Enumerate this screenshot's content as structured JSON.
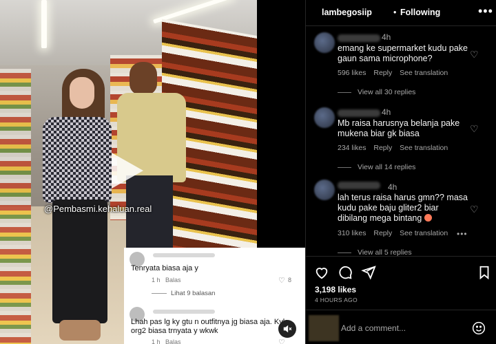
{
  "post": {
    "username": "lambegosiip",
    "separator": "•",
    "follow_status": "Following",
    "likes": "3,198 likes",
    "time_ago": "4 HOURS AGO",
    "comment_placeholder": "Add a comment..."
  },
  "video": {
    "watermark": "@Pembasmi.kehaluan.real",
    "overlay_comments": [
      {
        "text": "Tenryata biasa aja y",
        "time": "1 h",
        "reply": "Balas",
        "likes": "8",
        "view_replies": "Lihat 9 balasan"
      },
      {
        "text_line1": "Lhah pas lg ky gtu n outfitnya jg biasa aja. Kyk",
        "text_line2": "org2 biasa trnyata y wkwk",
        "time": "1 h",
        "reply": "Balas"
      }
    ]
  },
  "comments": [
    {
      "time": "4h",
      "text": "emang ke supermarket kudu pake gaun sama microphone?",
      "likes": "596 likes",
      "reply": "Reply",
      "translate": "See translation",
      "view_replies": "View all 30 replies"
    },
    {
      "time": "4h",
      "text": "Mb raisa harusnya belanja pake mukena biar gk biasa",
      "likes": "234 likes",
      "reply": "Reply",
      "translate": "See translation",
      "view_replies": "View all 14 replies"
    },
    {
      "time": "4h",
      "text": "lah terus raisa harus gmn?? masa kudu pake baju gliter2 biar dibilang mega bintang",
      "likes": "310 likes",
      "reply": "Reply",
      "translate": "See translation",
      "view_replies": "View all 5 replies"
    }
  ],
  "icons": {
    "like": "heart-icon",
    "comment": "comment-icon",
    "share": "share-icon",
    "save": "bookmark-icon",
    "more": "more-icon",
    "emoji": "emoji-icon",
    "mute": "mute-icon"
  }
}
